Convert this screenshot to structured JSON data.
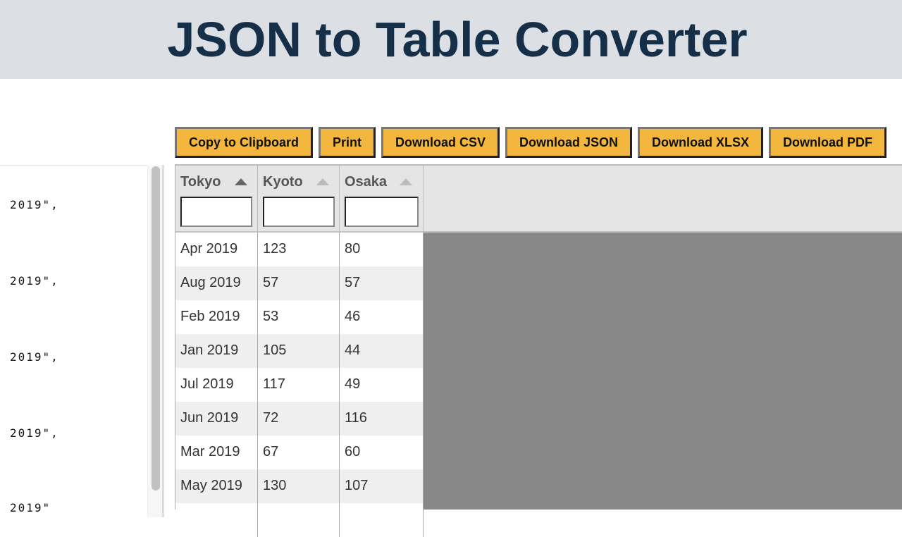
{
  "header": {
    "title": "JSON to Table Converter"
  },
  "editor": {
    "visible_lines": [
      "2019\",",
      "2019\",",
      "2019\",",
      "2019\",",
      "2019\""
    ]
  },
  "toolbar": {
    "buttons": [
      {
        "id": "copy",
        "label": "Copy to Clipboard"
      },
      {
        "id": "print",
        "label": "Print"
      },
      {
        "id": "csv",
        "label": "Download CSV"
      },
      {
        "id": "json",
        "label": "Download JSON"
      },
      {
        "id": "xlsx",
        "label": "Download XLSX"
      },
      {
        "id": "pdf",
        "label": "Download PDF"
      }
    ]
  },
  "table": {
    "columns": [
      {
        "title": "Tokyo",
        "sort": "ascending",
        "filter_value": ""
      },
      {
        "title": "Kyoto",
        "sort": "none",
        "filter_value": ""
      },
      {
        "title": "Osaka",
        "sort": "none",
        "filter_value": ""
      }
    ],
    "rows": [
      [
        "Apr 2019",
        "123",
        "80"
      ],
      [
        "Aug 2019",
        "57",
        "57"
      ],
      [
        "Feb 2019",
        "53",
        "46"
      ],
      [
        "Jan 2019",
        "105",
        "44"
      ],
      [
        "Jul 2019",
        "117",
        "49"
      ],
      [
        "Jun 2019",
        "72",
        "116"
      ],
      [
        "Mar 2019",
        "67",
        "60"
      ],
      [
        "May 2019",
        "130",
        "107"
      ],
      [
        "",
        "",
        ""
      ]
    ]
  },
  "colors": {
    "header_bg": "#dce0e5",
    "title": "#142f47",
    "button_bg": "#f3b73f",
    "table_empty_bg": "#888888"
  }
}
